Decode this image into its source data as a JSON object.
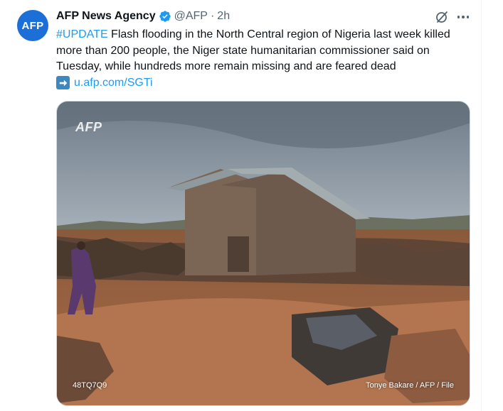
{
  "author": {
    "avatar_text": "AFP",
    "display_name": "AFP News Agency",
    "verified_icon": "verified-badge-icon",
    "handle": "@AFP",
    "separator": "·",
    "time": "2h"
  },
  "actions": {
    "grok_icon": "grok-icon",
    "more_icon": "more-icon"
  },
  "tweet": {
    "hashtag": "#UPDATE",
    "body": " Flash flooding in the North Central region of Nigeria last week killed more than 200 people, the Niger state humanitarian commissioner said on Tuesday, while hundreds more remain missing and are feared dead",
    "link_icon": "right-arrow-icon",
    "link": "u.afp.com/SGTi"
  },
  "media": {
    "watermark": "AFP",
    "photo_id": "48TQ7Q9",
    "credit": "Tonye Bakare / AFP / File"
  },
  "colors": {
    "accent": "#1d9bf0",
    "secondary_text": "#536471",
    "primary_text": "#0f1419",
    "avatar_bg": "#1d6fd8"
  }
}
